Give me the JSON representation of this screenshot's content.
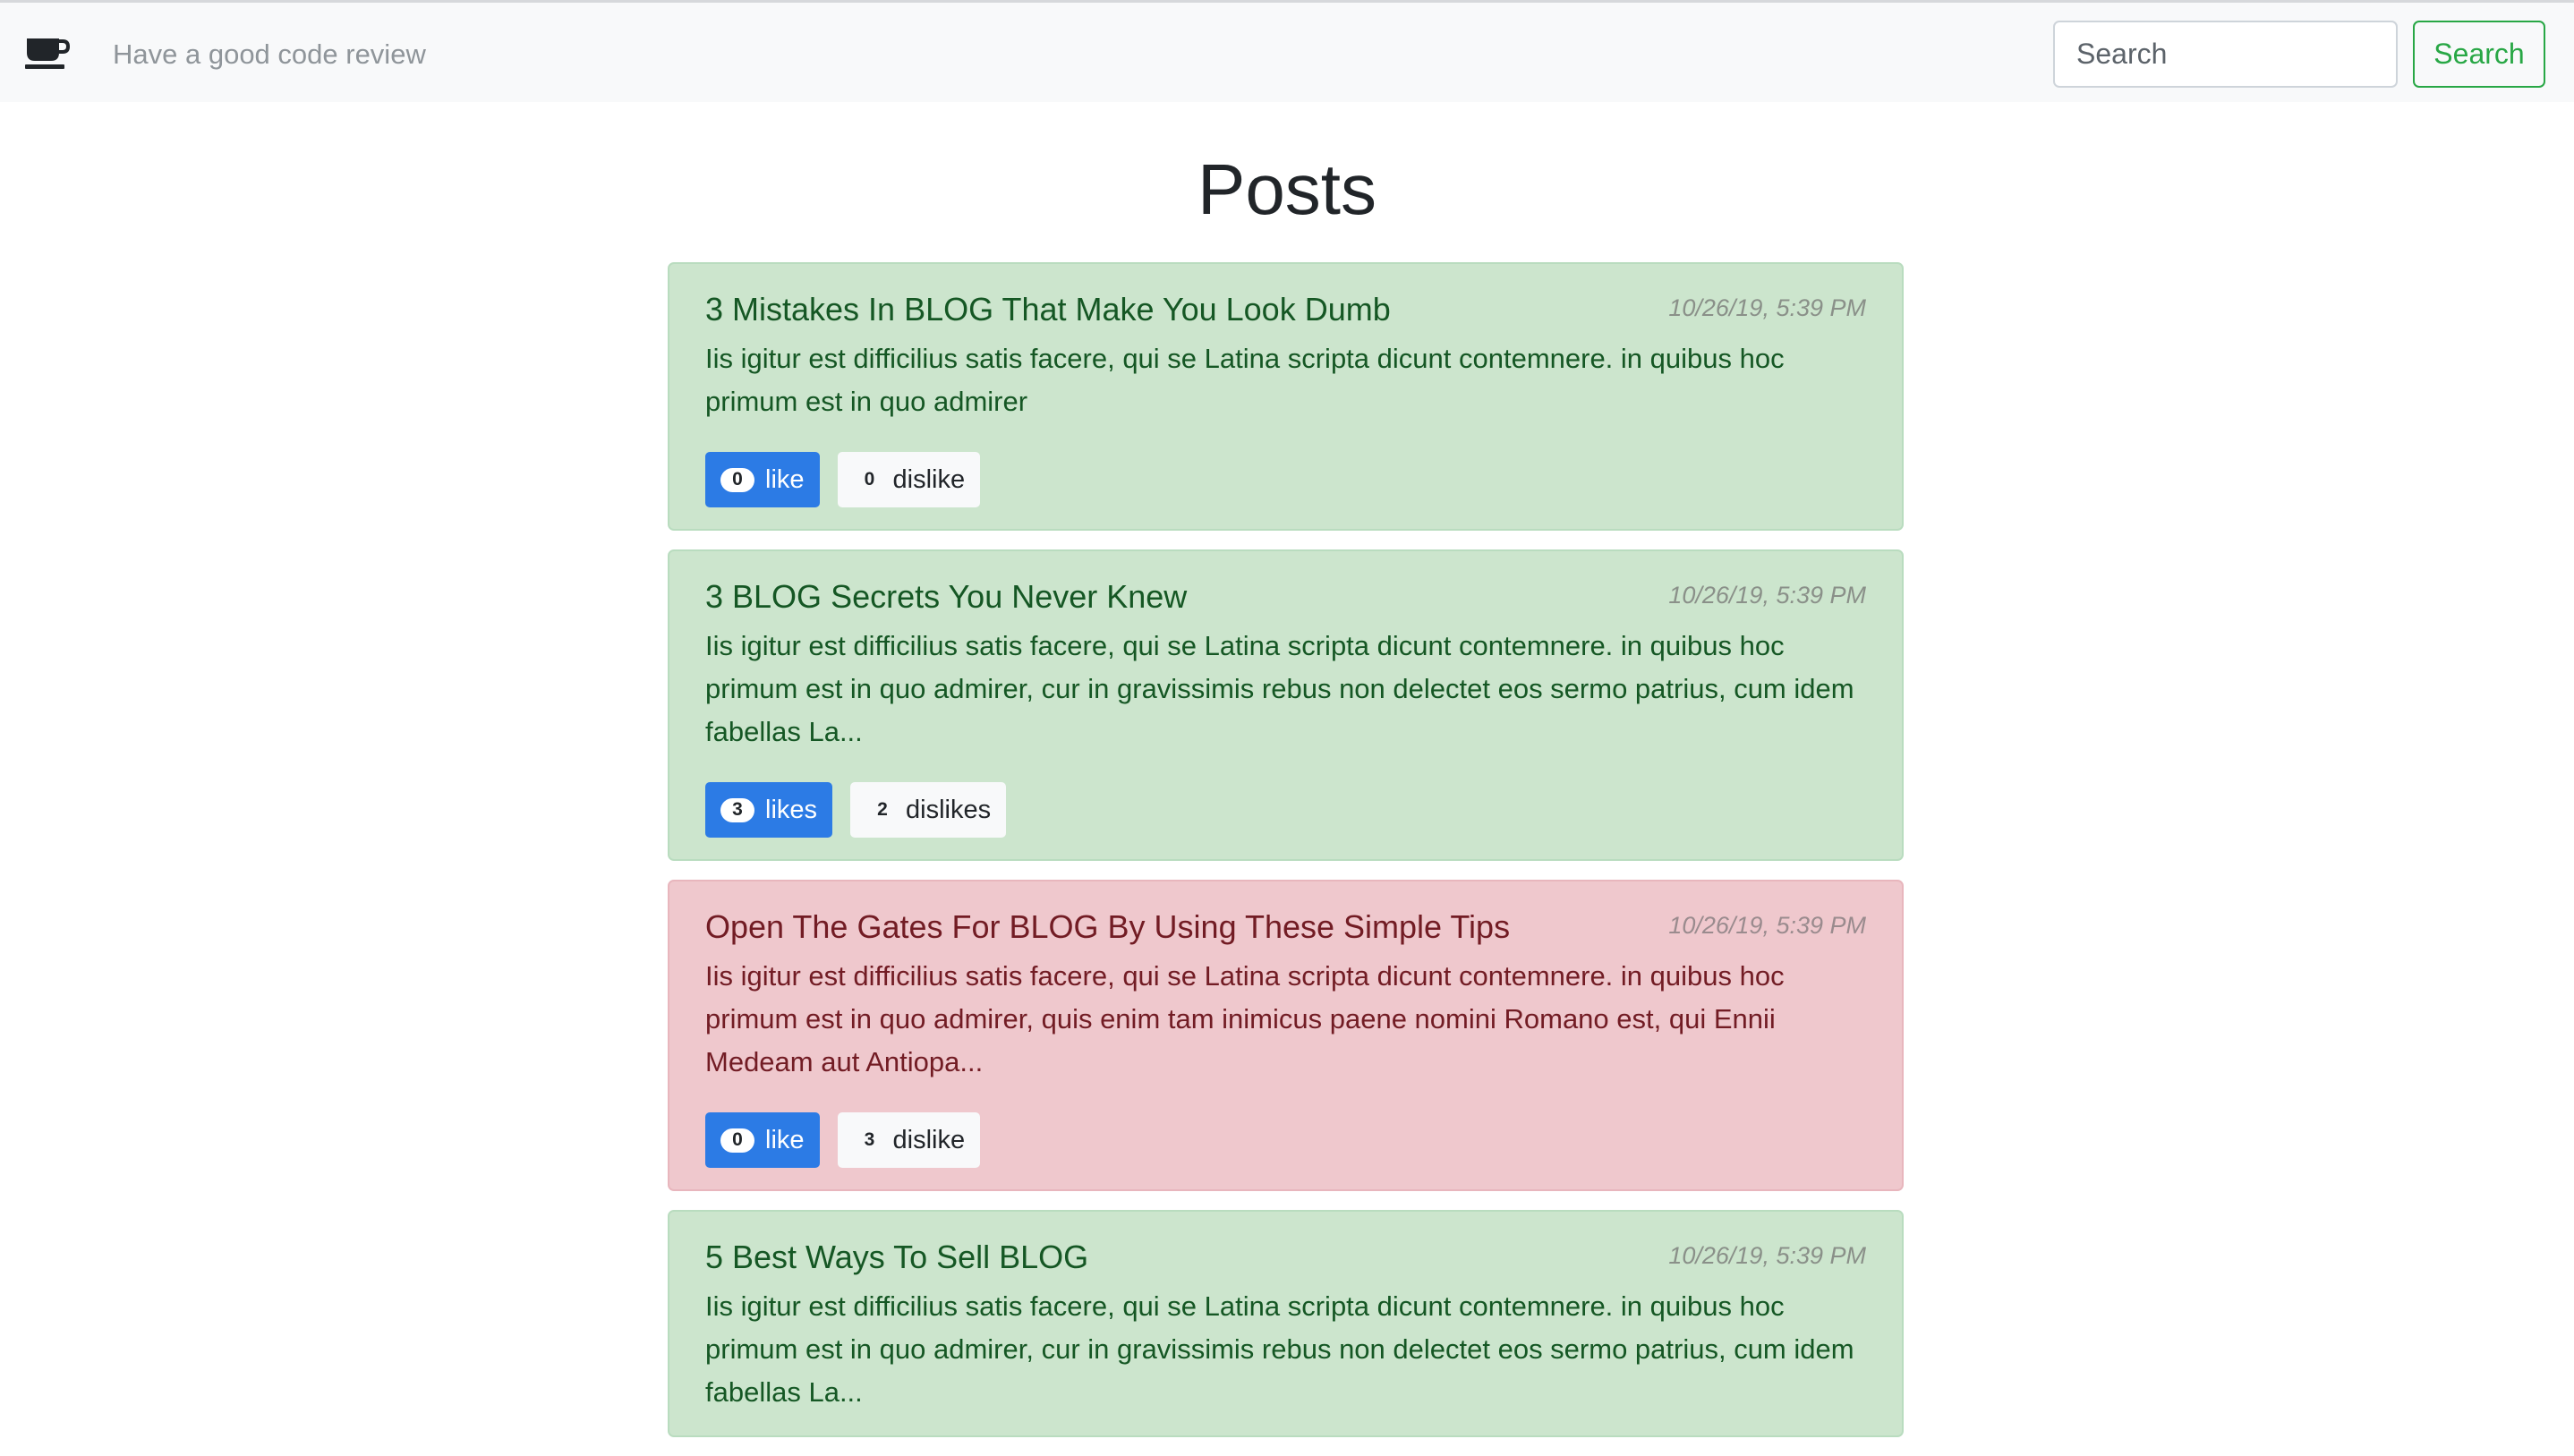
{
  "navbar": {
    "brand_icon": "coffee-cup-icon",
    "tagline": "Have a good code review",
    "search_placeholder": "Search",
    "search_button_label": "Search",
    "accent_color": "#28a745"
  },
  "page": {
    "title": "Posts"
  },
  "posts": [
    {
      "title": "3 Mistakes In BLOG That Make You Look Dumb",
      "date": "10/26/19, 5:39 PM",
      "body": "Iis igitur est difficilius satis facere, qui se Latina scripta dicunt contemnere. in quibus hoc primum est in quo admirer",
      "likes": "0",
      "like_label": "like",
      "dislikes": "0",
      "dislike_label": "dislike",
      "tone": "positive"
    },
    {
      "title": "3 BLOG Secrets You Never Knew",
      "date": "10/26/19, 5:39 PM",
      "body": "Iis igitur est difficilius satis facere, qui se Latina scripta dicunt contemnere. in quibus hoc primum est in quo admirer, cur in gravissimis rebus non delectet eos sermo patrius, cum idem fabellas La...",
      "likes": "3",
      "like_label": "likes",
      "dislikes": "2",
      "dislike_label": "dislikes",
      "tone": "positive"
    },
    {
      "title": "Open The Gates For BLOG By Using These Simple Tips",
      "date": "10/26/19, 5:39 PM",
      "body": "Iis igitur est difficilius satis facere, qui se Latina scripta dicunt contemnere. in quibus hoc primum est in quo admirer, quis enim tam inimicus paene nomini Romano est, qui Ennii Medeam aut Antiopa...",
      "likes": "0",
      "like_label": "like",
      "dislikes": "3",
      "dislike_label": "dislike",
      "tone": "negative"
    },
    {
      "title": "5 Best Ways To Sell BLOG",
      "date": "10/26/19, 5:39 PM",
      "body": "Iis igitur est difficilius satis facere, qui se Latina scripta dicunt contemnere. in quibus hoc primum est in quo admirer, cur in gravissimis rebus non delectet eos sermo patrius, cum idem fabellas La...",
      "likes": "",
      "like_label": "",
      "dislikes": "",
      "dislike_label": "",
      "tone": "positive"
    }
  ]
}
